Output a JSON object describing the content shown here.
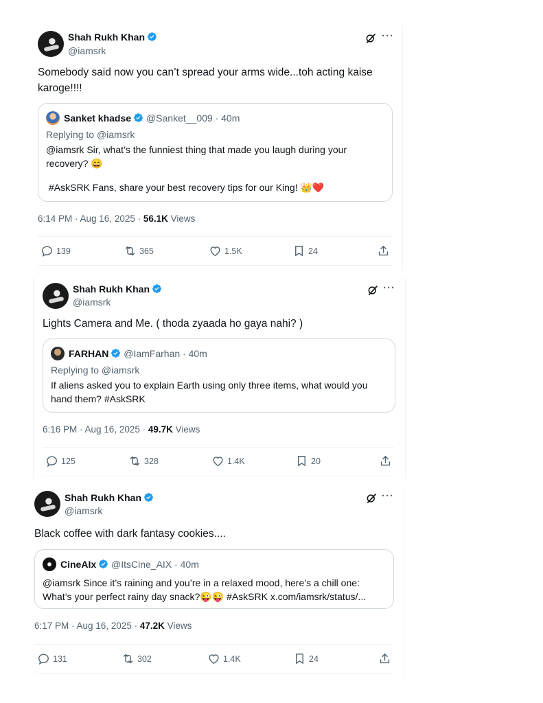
{
  "colors": {
    "accent": "#1d9bf0",
    "text": "#0f1419",
    "muted": "#536471",
    "border": "#cfd9de",
    "heart": "#e0245e"
  },
  "tweets": [
    {
      "name": "Shah Rukh Khan",
      "handle": "@iamsrk",
      "text": "Somebody said now you can’t spread your arms wide...toh acting kaise karoge!!!!",
      "quote": {
        "name": "Sanket khadse",
        "meta": "@Sanket__009 · 40m",
        "replying": "Replying to @iamsrk",
        "line1": "@iamsrk Sir, what’s the funniest thing that made you laugh during your recovery? 😄",
        "line2": "#AskSRK Fans, share your best recovery tips for our King! 👑❤️"
      },
      "time": "6:14 PM · Aug 16, 2025 · ",
      "views": "56.1K",
      "views_label": " Views",
      "replies": "139",
      "reposts": "365",
      "likes": "1.5K",
      "bookmarks": "24"
    },
    {
      "name": "Shah Rukh Khan",
      "handle": "@iamsrk",
      "text": "Lights Camera and Me. ( thoda zyaada ho gaya nahi? )",
      "quote": {
        "name": "FARHAN",
        "meta": "@IamFarhan · 40m",
        "replying": "Replying to @iamsrk",
        "line1": "If aliens asked you to explain Earth using only three items, what would you hand them? #AskSRK"
      },
      "time": "6:16 PM · Aug 16, 2025 · ",
      "views": "49.7K",
      "views_label": " Views",
      "replies": "125",
      "reposts": "328",
      "likes": "1.4K",
      "bookmarks": "20"
    },
    {
      "name": "Shah Rukh Khan",
      "handle": "@iamsrk",
      "text": "Black coffee with dark fantasy cookies....",
      "quote": {
        "name": "CineAIx",
        "meta": "@ItsCine_AIX · 40m",
        "line1": "@iamsrk Since it’s raining and you’re in a relaxed mood, here’s a chill one: What’s your perfect rainy day snack?😜😜 #AskSRK x.com/iamsrk/status/..."
      },
      "time": "6:17 PM · Aug 16, 2025 · ",
      "views": "47.2K",
      "views_label": " Views",
      "replies": "131",
      "reposts": "302",
      "likes": "1.4K",
      "bookmarks": "24"
    }
  ]
}
